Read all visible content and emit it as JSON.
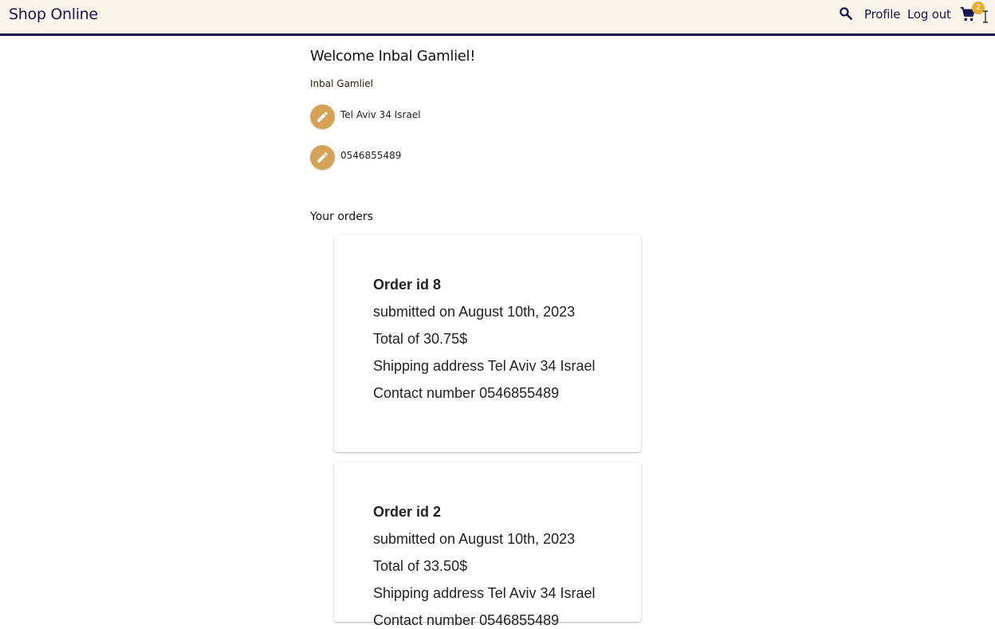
{
  "app": {
    "title": "Shop Online"
  },
  "nav": {
    "profile": "Profile",
    "logout": "Log out",
    "cart_count": "2"
  },
  "user": {
    "welcome": "Welcome Inbal Gamliel!",
    "name": "Inbal Gamliel",
    "address": "Tel Aviv 34 Israel",
    "phone": "0546855489"
  },
  "orders_title": "Your orders",
  "orders": [
    {
      "id": "Order id 8",
      "submitted": "submitted on August 10th, 2023",
      "total": "Total of 30.75$",
      "shipping": "Shipping address Tel Aviv 34 Israel",
      "contact": "Contact number 0546855489"
    },
    {
      "id": "Order id 2",
      "submitted": "submitted on August 10th, 2023",
      "total": "Total of 33.50$",
      "shipping": "Shipping address Tel Aviv 34 Israel",
      "contact": "Contact number 0546855489"
    }
  ],
  "colors": {
    "accent": "#d5a257",
    "navy": "#14164f",
    "header_bg": "#faf4ea",
    "badge": "#e6ad2a"
  }
}
